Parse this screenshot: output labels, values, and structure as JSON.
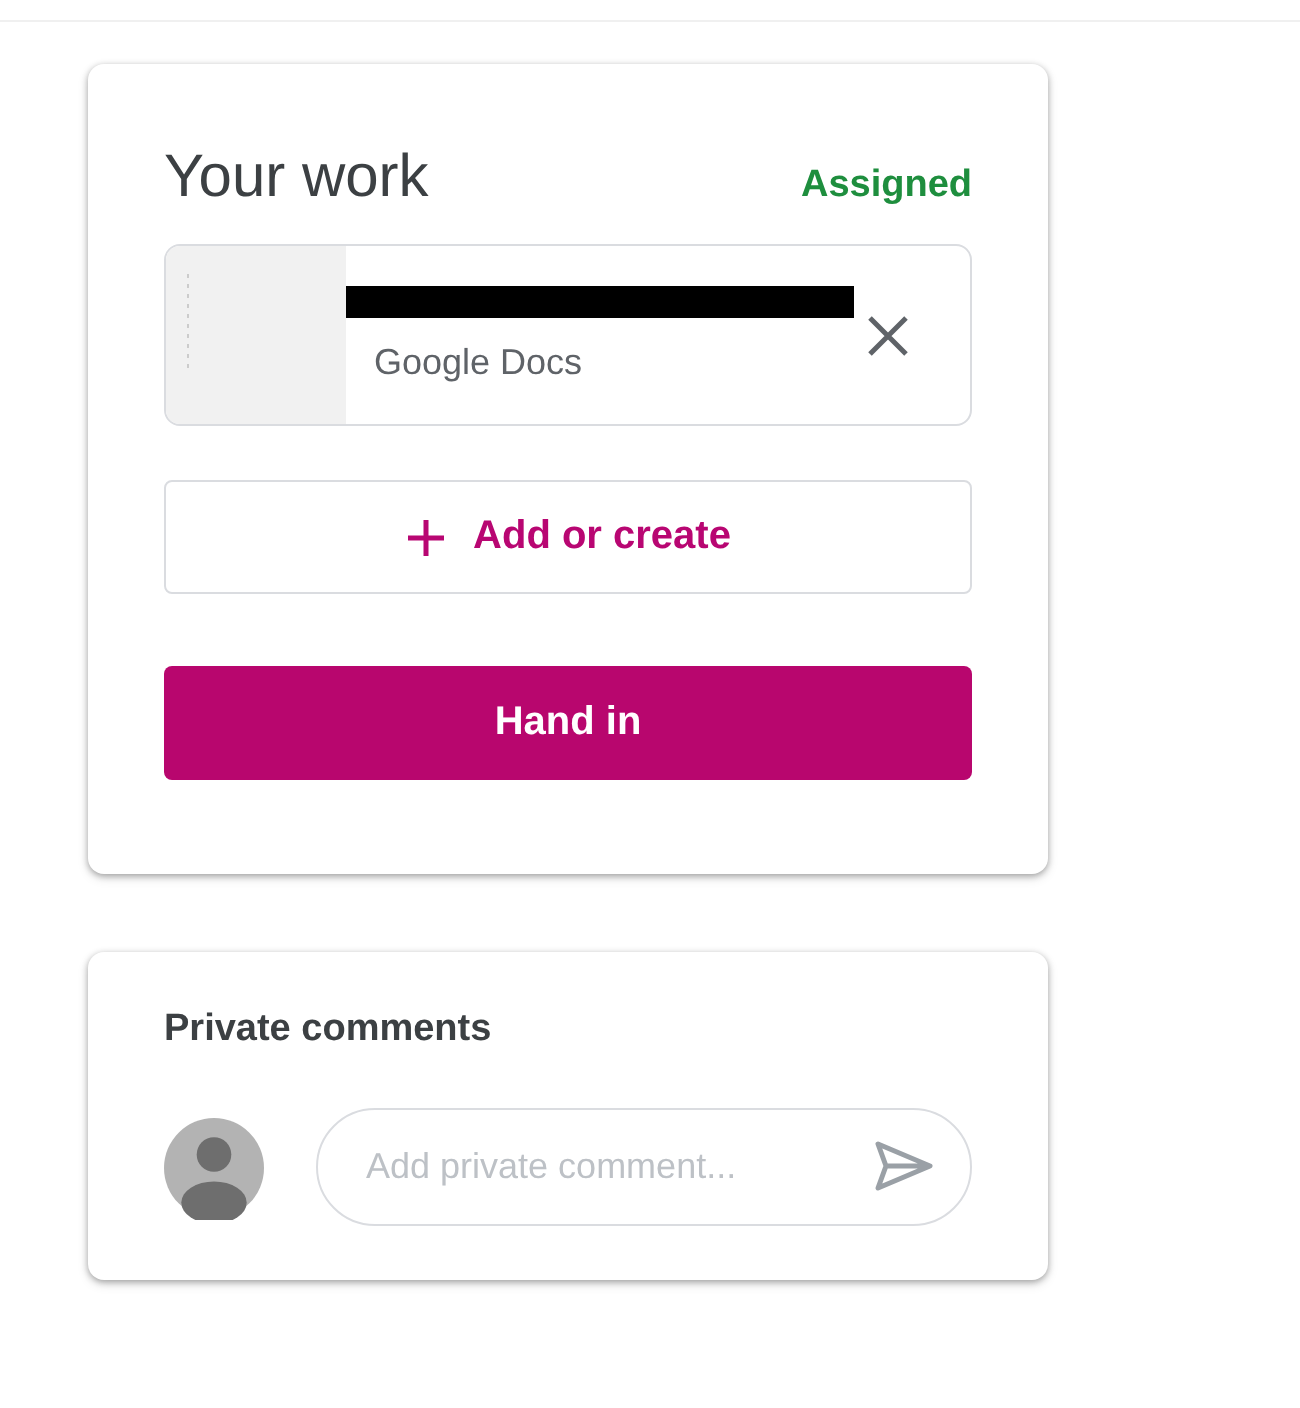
{
  "work_card": {
    "title": "Your work",
    "status": "Assigned",
    "attachment": {
      "type": "Google Docs",
      "redacted": true
    },
    "add_button": {
      "label": "Add or create"
    },
    "hand_in_button": {
      "label": "Hand in"
    }
  },
  "comments_card": {
    "title": "Private comments",
    "field": {
      "placeholder": "Add private comment..."
    }
  }
}
